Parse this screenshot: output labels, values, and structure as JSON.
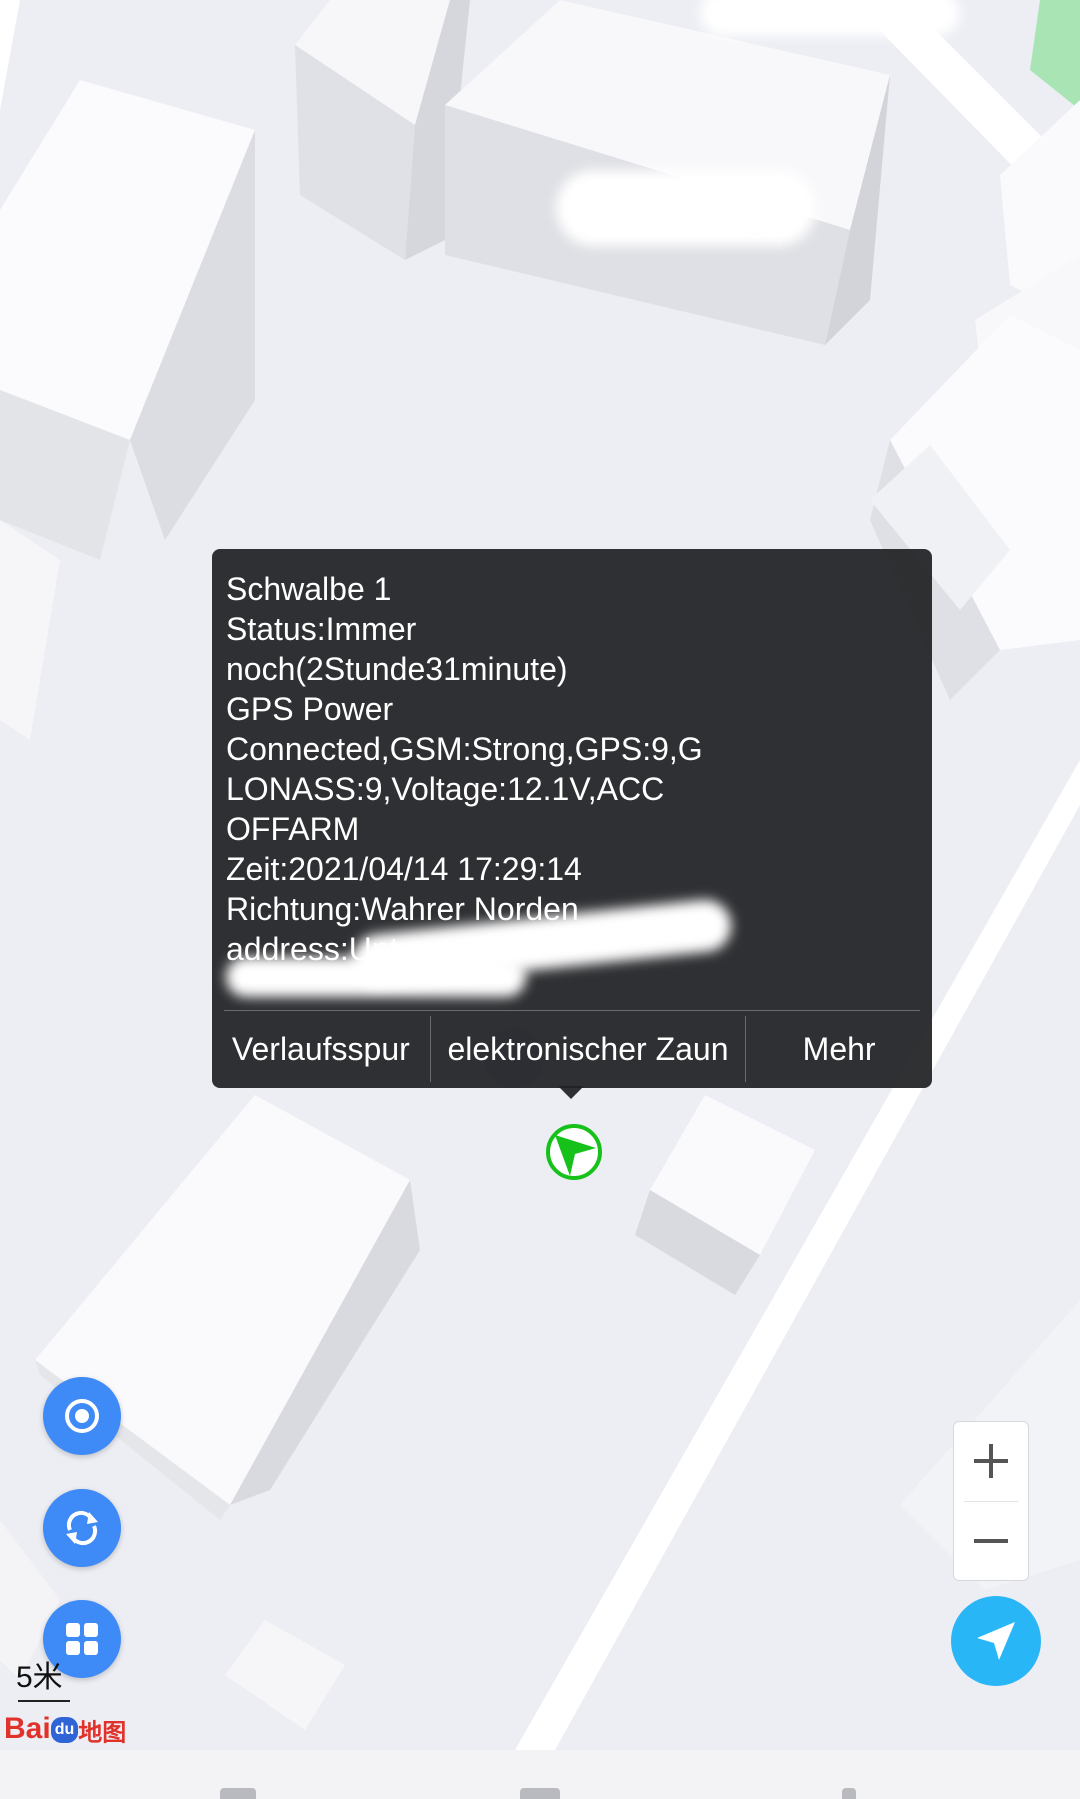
{
  "popup": {
    "lines": [
      "Schwalbe 1",
      "Status:Immer",
      "noch(2Stunde31minute)",
      "GPS Power",
      "Connected,GSM:Strong,GPS:9,G",
      "LONASS:9,Voltage:12.1V,ACC",
      "OFFARM",
      "Zeit:2021/04/14 17:29:14",
      "Richtung:Wahrer Norden",
      "address:Unt",
      ""
    ],
    "actions": [
      "Verlaufsspur",
      "elektronischer Zaun",
      "Mehr"
    ]
  },
  "controls": {
    "left_buttons": [
      "target-icon",
      "refresh-icon",
      "grid-icon"
    ],
    "zoom_in": "+",
    "zoom_out": "−",
    "locate_icon": "navigation-arrow-icon"
  },
  "map": {
    "scale_label": "5米",
    "logo": {
      "bai": "Bai",
      "du": "du",
      "ditu": "地图"
    },
    "marker_icon": "direction-marker-icon",
    "poi_icon": "poi-icon"
  },
  "colors": {
    "map_bg": "#eceef4",
    "fab_blue": "#3e8bf7",
    "locate_blue": "#29b6f6",
    "marker_green": "#16c21a",
    "popup_bg": "#202124"
  }
}
